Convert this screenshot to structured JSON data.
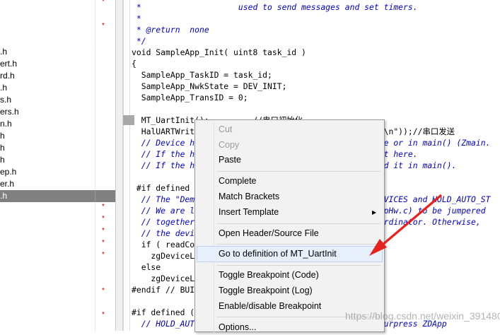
{
  "tree": {
    "rows": [
      {
        "name": "",
        "star": true
      },
      {
        "name": "",
        "star": false
      },
      {
        "name": "",
        "star": true
      },
      {
        "name": "",
        "star": false
      },
      {
        "name": ".h",
        "star": false
      },
      {
        "name": "ert.h",
        "star": false
      },
      {
        "name": "rd.h",
        "star": false
      },
      {
        "name": ".h",
        "star": false
      },
      {
        "name": "s.h",
        "star": false
      },
      {
        "name": "ers.h",
        "star": false
      },
      {
        "name": "n.h",
        "star": false
      },
      {
        "name": "h",
        "star": false
      },
      {
        "name": "h",
        "star": false
      },
      {
        "name": "h",
        "star": false
      },
      {
        "name": "ep.h",
        "star": false
      },
      {
        "name": "er.h",
        "star": false
      },
      {
        "name": ".h",
        "star": false,
        "selected": true
      },
      {
        "name": "",
        "star": true
      },
      {
        "name": "",
        "star": true
      },
      {
        "name": "",
        "star": true
      },
      {
        "name": "",
        "star": true
      },
      {
        "name": "",
        "star": true
      },
      {
        "name": "",
        "star": false
      },
      {
        "name": "",
        "star": false
      },
      {
        "name": "",
        "star": true
      },
      {
        "name": "",
        "star": false
      },
      {
        "name": "",
        "star": true
      },
      {
        "name": "",
        "star": false
      }
    ]
  },
  "code": {
    "lines": [
      {
        "text": " *                    used to send messages and set timers.",
        "comment": true
      },
      {
        "text": " *",
        "comment": true
      },
      {
        "text": " * @return  none",
        "comment": true
      },
      {
        "text": " */",
        "comment": true
      },
      {
        "text": "void SampleApp_Init( uint8 task_id )",
        "comment": false
      },
      {
        "text": "{",
        "comment": false
      },
      {
        "text": "  SampleApp_TaskID = task_id;",
        "comment": false
      },
      {
        "text": "  SampleApp_NwkState = DEV_INIT;",
        "comment": false
      },
      {
        "text": "  SampleApp_TransID = 0;",
        "comment": false
      },
      {
        "text": "",
        "comment": false
      },
      {
        "text": "  MT_UartInit();         //串口初始化",
        "comment": false
      },
      {
        "text": "  HalUARTWrite(0,\"Hello World\\n\",sizeof(\"Hello World\\n\"));//串口发送",
        "comment": false
      },
      {
        "text": "  // Device hardware initialization can be added here or in main() (Zmain.",
        "comment": true
      },
      {
        "text": "  // If the hardware is application specific - add it here.",
        "comment": true
      },
      {
        "text": "  // If the hardware is other parts of the device add it in main().",
        "comment": true
      },
      {
        "text": "",
        "comment": false
      },
      {
        "text": " #if defined ( BUILD_ALL_DEVICES )",
        "comment": false
      },
      {
        "text": "  // The \"Demo\" target is setup to have BUILD_ALL_DEVICES and HOLD_AUTO_ST",
        "comment": true
      },
      {
        "text": "  // We are looking at a jumper (defined in SampleAppHw.c) to be jumpered",
        "comment": true
      },
      {
        "text": "  // together - if they are - we will start up a coordinator. Otherwise,",
        "comment": true
      },
      {
        "text": "  // the device will start as a router.",
        "comment": true
      },
      {
        "text": "  if ( readCoordinatorJumper() )",
        "comment": false
      },
      {
        "text": "    zgDeviceLogicalType = ZG_DEVICETYPE_COORDINATOR;",
        "comment": false
      },
      {
        "text": "  else",
        "comment": false
      },
      {
        "text": "    zgDeviceLogicalType = ZG_DEVICETYPE_ROUTER;",
        "comment": false
      },
      {
        "text": "#endif // BUILD_ALL_DEVICES",
        "comment": false
      },
      {
        "text": "",
        "comment": false
      },
      {
        "text": "#if defined ( HOLD_AUTO_START )",
        "comment": false
      },
      {
        "text": "  // HOLD_AUTO_START is a compile option that will surpress ZDApp",
        "comment": true
      }
    ]
  },
  "context_menu": {
    "items": [
      {
        "label": "Cut",
        "disabled": true
      },
      {
        "label": "Copy",
        "disabled": true
      },
      {
        "label": "Paste",
        "disabled": false
      },
      {
        "label": "Complete",
        "disabled": false
      },
      {
        "label": "Match Brackets",
        "disabled": false
      },
      {
        "label": "Insert Template",
        "disabled": false,
        "submenu": "▶"
      },
      {
        "label": "Open Header/Source File",
        "disabled": false
      },
      {
        "label": "Go to definition of MT_UartInit",
        "disabled": false,
        "highlighted": true
      },
      {
        "label": "Toggle Breakpoint (Code)",
        "disabled": false
      },
      {
        "label": "Toggle Breakpoint (Log)",
        "disabled": false
      },
      {
        "label": "Enable/disable Breakpoint",
        "disabled": false
      },
      {
        "label": "Options...",
        "disabled": false
      }
    ]
  },
  "watermark": "https://blog.csdn.net/weixin_39148042",
  "colors": {
    "comment": "#0000c8",
    "star": "#d40000",
    "arrow": "#e8211d",
    "selected_row": "#808080"
  }
}
